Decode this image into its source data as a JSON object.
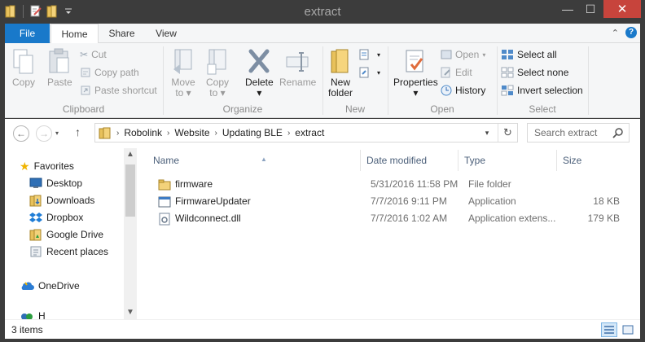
{
  "window": {
    "title": "extract",
    "minimize_glyph": "—",
    "maximize_glyph": "☐",
    "close_glyph": "✕"
  },
  "ribbon_tabs": {
    "file": "File",
    "home": "Home",
    "share": "Share",
    "view": "View",
    "help_glyph": "?",
    "collapse_glyph": "⌃"
  },
  "ribbon": {
    "clipboard": {
      "label": "Clipboard",
      "copy": "Copy",
      "paste": "Paste",
      "cut": "Cut",
      "copy_path": "Copy path",
      "paste_shortcut": "Paste shortcut"
    },
    "organize": {
      "label": "Organize",
      "move_to_line1": "Move",
      "move_to_line2": "to",
      "copy_to_line1": "Copy",
      "copy_to_line2": "to",
      "delete": "Delete",
      "rename": "Rename"
    },
    "new": {
      "label": "New",
      "new_folder_line1": "New",
      "new_folder_line2": "folder"
    },
    "open": {
      "label": "Open",
      "properties": "Properties",
      "open": "Open",
      "edit": "Edit",
      "history": "History"
    },
    "select": {
      "label": "Select",
      "select_all": "Select all",
      "select_none": "Select none",
      "invert_selection": "Invert selection"
    }
  },
  "address": {
    "crumbs": [
      "Robolink",
      "Website",
      "Updating BLE",
      "extract"
    ],
    "search_placeholder": "Search extract",
    "back_glyph": "←",
    "forward_glyph": "→",
    "up_glyph": "↑",
    "refresh_glyph": "↻",
    "dropdown_glyph": "▾"
  },
  "nav": {
    "favorites": "Favorites",
    "items": [
      "Desktop",
      "Downloads",
      "Dropbox",
      "Google Drive",
      "Recent places"
    ],
    "onedrive": "OneDrive",
    "partial": "H"
  },
  "columns": {
    "name": "Name",
    "date_modified": "Date modified",
    "type": "Type",
    "size": "Size",
    "sort_glyph": "▲"
  },
  "files": [
    {
      "name": "firmware",
      "date": "5/31/2016 11:58 PM",
      "type": "File folder",
      "size": "",
      "icon": "folder-icon"
    },
    {
      "name": "FirmwareUpdater",
      "date": "7/7/2016 9:11 PM",
      "type": "Application",
      "size": "18 KB",
      "icon": "application-icon"
    },
    {
      "name": "Wildconnect.dll",
      "date": "7/7/2016 1:02 AM",
      "type": "Application extens...",
      "size": "179 KB",
      "icon": "dll-file-icon"
    }
  ],
  "status": {
    "item_count": "3 items"
  },
  "colors": {
    "accent": "#1979ca",
    "close": "#c7443c",
    "titlebar": "#3c3c3c"
  }
}
